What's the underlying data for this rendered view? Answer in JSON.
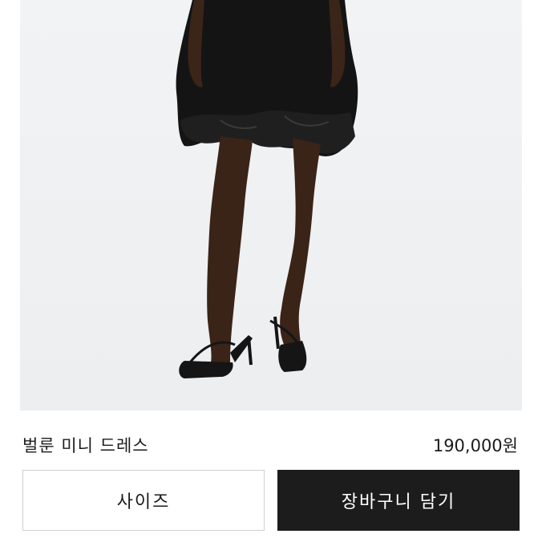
{
  "product": {
    "name": "벌룬 미니 드레스",
    "price": "190,000원",
    "image_alt": "black balloon mini dress worn by model with strappy heeled sandals"
  },
  "actions": {
    "size_label": "사이즈",
    "cart_label": "장바구니 담기"
  },
  "colors": {
    "cart_button_bg": "#1c1c1c",
    "size_button_border": "#cfcfcf",
    "photo_background": "#eef0f2"
  }
}
